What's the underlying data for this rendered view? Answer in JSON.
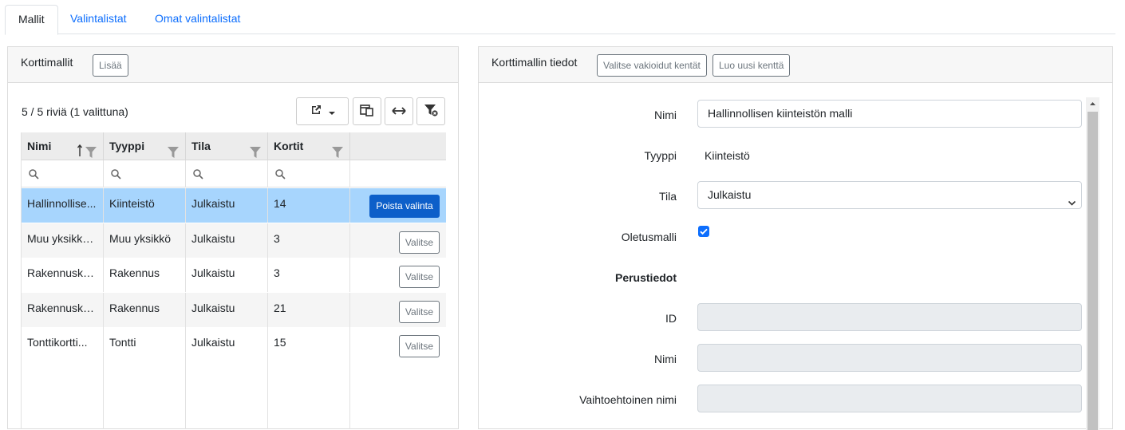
{
  "tabs": [
    {
      "label": "Mallit",
      "active": true
    },
    {
      "label": "Valintalistat",
      "active": false
    },
    {
      "label": "Omat valintalistat",
      "active": false
    }
  ],
  "left_panel": {
    "title": "Korttimallit",
    "add_label": "Lisää",
    "row_count": "5 / 5 riviä (1 valittuna)",
    "toolbar_icons": [
      "export-icon",
      "chevron-down-icon",
      "column-chooser-icon",
      "fit-columns-icon",
      "clear-filter-icon"
    ],
    "columns": [
      "Nimi",
      "Tyyppi",
      "Tila",
      "Kortit"
    ],
    "rows": [
      {
        "nimi": "Hallinnollisen kiinteistön malli",
        "tyyppi": "Kiinteistö",
        "tila": "Julkaistu",
        "kortit": "14",
        "action": "Poista valinta",
        "selected": true
      },
      {
        "nimi": "Muu yksikkö",
        "tyyppi": "Muu yksikkö",
        "tila": "Julkaistu",
        "kortit": "3",
        "action": "Valitse",
        "selected": false
      },
      {
        "nimi": "Rakennuskortti",
        "tyyppi": "Rakennus",
        "tila": "Julkaistu",
        "kortit": "3",
        "action": "Valitse",
        "selected": false
      },
      {
        "nimi": "Rakennuskortti",
        "tyyppi": "Rakennus",
        "tila": "Julkaistu",
        "kortit": "21",
        "action": "Valitse",
        "selected": false
      },
      {
        "nimi": "Tonttikortti",
        "tyyppi": "Tontti",
        "tila": "Julkaistu",
        "kortit": "15",
        "action": "Valitse",
        "selected": false
      }
    ],
    "row_display": [
      "Hallinnollise...",
      "Muu yksikkö...",
      "Rakennusko...",
      "Rakennusko...",
      "Tonttikortti..."
    ]
  },
  "right_panel": {
    "title": "Korttimallin tiedot",
    "btn_standard_fields": "Valitse vakioidut kentät",
    "btn_new_field": "Luo uusi kenttä",
    "fields": {
      "nimi_label": "Nimi",
      "nimi_value": "Hallinnollisen kiinteistön malli",
      "tyyppi_label": "Tyyppi",
      "tyyppi_value": "Kiinteistö",
      "tila_label": "Tila",
      "tila_value": "Julkaistu",
      "oletusmalli_label": "Oletusmalli",
      "oletusmalli_checked": true,
      "section_label": "Perustiedot",
      "id_label": "ID",
      "id_value": "",
      "nimi2_label": "Nimi",
      "nimi2_value": "",
      "alt_name_label": "Vaihtoehtoinen nimi",
      "alt_name_value": ""
    }
  },
  "colors": {
    "accent": "#0d6efd",
    "selected_row": "#a7d5fd",
    "deselect_button": "#0d5fc9"
  }
}
